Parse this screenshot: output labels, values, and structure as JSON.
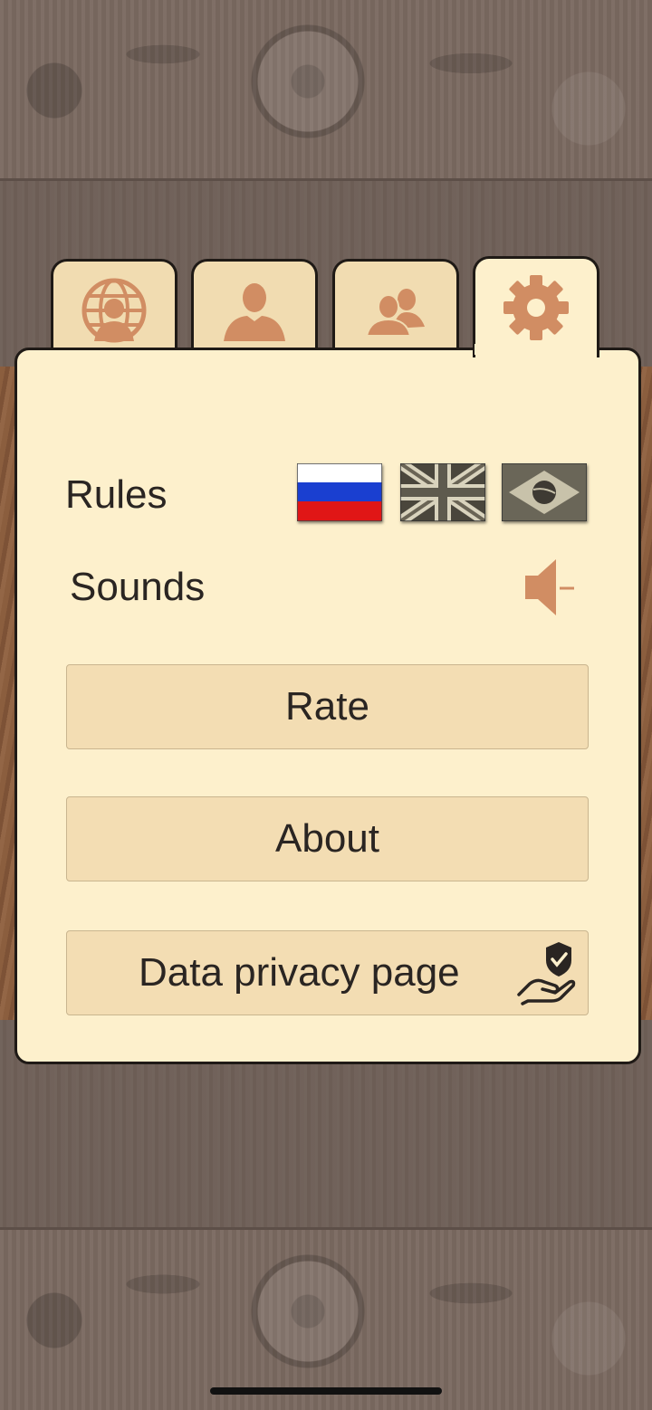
{
  "tabs": [
    {
      "icon": "globe-person-icon",
      "active": false
    },
    {
      "icon": "person-icon",
      "active": false
    },
    {
      "icon": "two-persons-icon",
      "active": false
    },
    {
      "icon": "gear-icon",
      "active": true
    }
  ],
  "settings": {
    "rules_label": "Rules",
    "rules_flags": [
      "russia-flag",
      "uk-flag",
      "brazil-flag"
    ],
    "sounds_label": "Sounds",
    "sound_icon": "speaker-muted-icon"
  },
  "buttons": {
    "rate": "Rate",
    "about": "About",
    "privacy": "Data privacy page"
  },
  "colors": {
    "icon_accent": "#d18d63",
    "panel_bg": "#fdf0cc",
    "button_bg": "#f3ddb3"
  }
}
